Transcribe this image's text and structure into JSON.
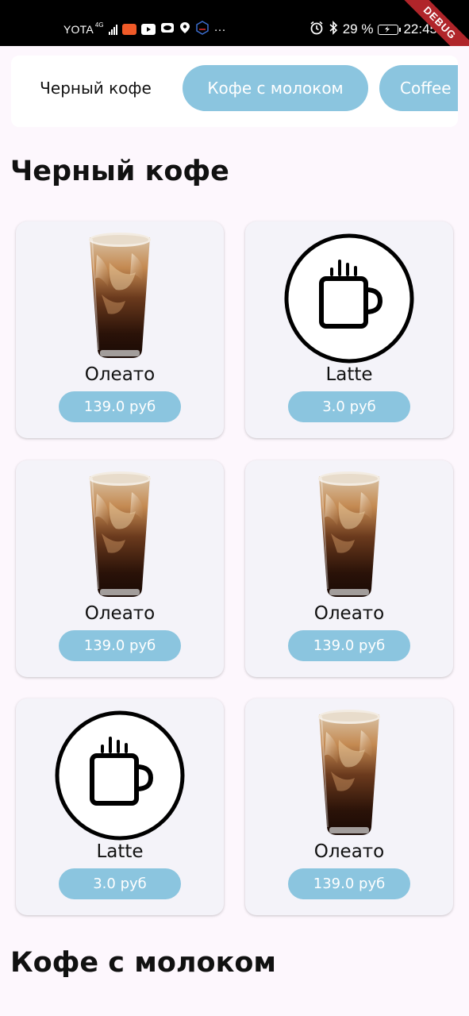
{
  "status_bar": {
    "carrier": "YOTA",
    "network": "4G",
    "battery": "29 %",
    "time": "22:45",
    "ellipsis": "···"
  },
  "debug_banner": "DEBUG",
  "tabs": [
    {
      "label": "Черный кофе",
      "selected": true
    },
    {
      "label": "Кофе с молоком",
      "selected": false
    },
    {
      "label": "Coffee",
      "selected": false
    }
  ],
  "sections": [
    {
      "title": "Черный кофе",
      "products": [
        {
          "name": "Олеато",
          "price": "139.0 руб",
          "icon": "iced-coffee-image"
        },
        {
          "name": "Latte",
          "price": "3.0 руб",
          "icon": "coffee-mug-icon"
        },
        {
          "name": "Олеато",
          "price": "139.0 руб",
          "icon": "iced-coffee-image"
        },
        {
          "name": "Олеато",
          "price": "139.0 руб",
          "icon": "iced-coffee-image"
        },
        {
          "name": "Latte",
          "price": "3.0 руб",
          "icon": "coffee-mug-icon"
        },
        {
          "name": "Олеато",
          "price": "139.0 руб",
          "icon": "iced-coffee-image"
        }
      ]
    },
    {
      "title": "Кофе с молоком",
      "products": []
    }
  ],
  "colors": {
    "accent": "#8bc5df",
    "background": "#fdf7fd",
    "card": "#f4f3f9",
    "debug": "#b0252a"
  }
}
